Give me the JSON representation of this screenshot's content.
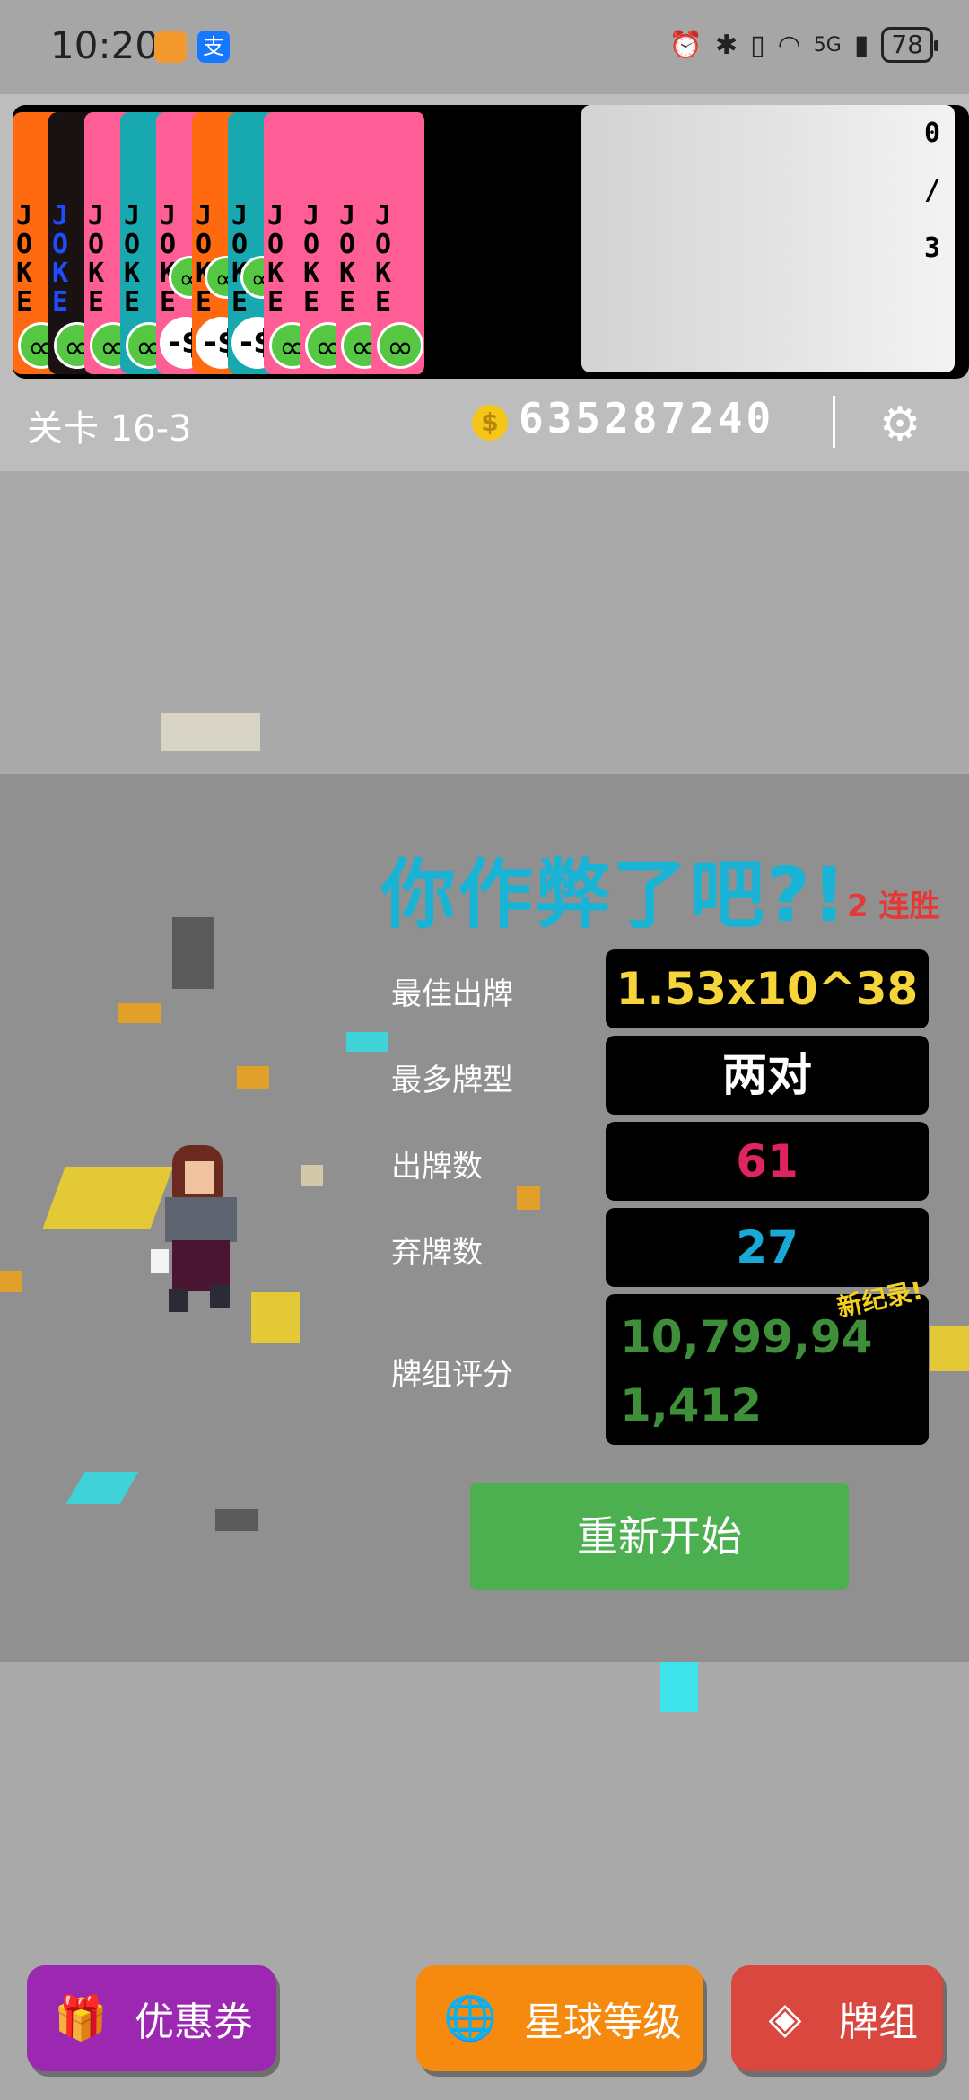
{
  "status_bar": {
    "time": "10:20",
    "network": "5G",
    "battery": "78"
  },
  "header": {
    "counter": [
      "0",
      "/",
      "3"
    ],
    "level_label": "关卡 16-3",
    "money": "635287240",
    "coin_symbol": "$",
    "settings_icon": "gear-icon"
  },
  "jokers": {
    "text": "JOKE",
    "inf_symbol": "∞",
    "dollar_symbol": "-$"
  },
  "result": {
    "title": "你作弊了吧?!",
    "streak": "2 连胜",
    "stats": [
      {
        "label": "最佳出牌",
        "value": "1.53x10^38",
        "color": "#f5d53a"
      },
      {
        "label": "最多牌型",
        "value": "两对",
        "color": "#ffffff"
      },
      {
        "label": "出牌数",
        "value": "61",
        "color": "#e0245e"
      },
      {
        "label": "弃牌数",
        "value": "27",
        "color": "#19a9d6"
      }
    ],
    "score_label": "牌组评分",
    "score_value": "10,799,941,412",
    "new_record": "新纪录!",
    "restart_label": "重新开始"
  },
  "bottom_nav": {
    "coupon_label": "优惠券",
    "planet_label": "星球等级",
    "deck_label": "牌组",
    "coupon_color": "#9c27b0",
    "planet_color": "#f58a0f",
    "deck_color": "#d9473f"
  }
}
